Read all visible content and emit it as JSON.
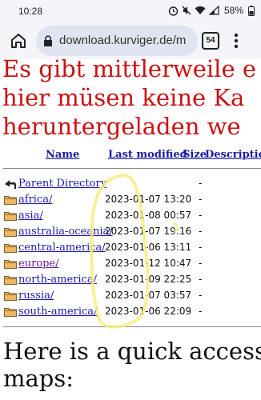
{
  "status_bar": {
    "time": "10:28",
    "battery": "58%"
  },
  "browser": {
    "url": "download.kurviger.de/m",
    "tab_count": "54"
  },
  "page": {
    "heading_lines": [
      "Es gibt mittlerweile e",
      "hier müsen keine Ka",
      "heruntergeladen we"
    ],
    "columns": {
      "name": "Name",
      "last_modified": "Last modified",
      "size": "Size",
      "description": "Description"
    },
    "parent": {
      "label": "Parent Directory",
      "size": "-"
    },
    "rows": [
      {
        "name": "africa/",
        "date": "2023-01-07 13:20",
        "size": "-"
      },
      {
        "name": "asia/",
        "date": "2023-01-08 00:57",
        "size": "-"
      },
      {
        "name": "australia-oceania/",
        "date": "2023-01-07 19:16",
        "size": "-"
      },
      {
        "name": "central-america/",
        "date": "2023-01-06 13:11",
        "size": "-"
      },
      {
        "name": "europe/",
        "date": "2023-01-12 10:47",
        "size": "-"
      },
      {
        "name": "north-america/",
        "date": "2023-01-09 22:25",
        "size": "-"
      },
      {
        "name": "russia/",
        "date": "2023-01-07 03:57",
        "size": "-"
      },
      {
        "name": "south-america/",
        "date": "2023-01-06 22:09",
        "size": "-"
      }
    ],
    "quick_lines": [
      "Here is a quick access",
      "maps:"
    ]
  },
  "colors": {
    "heading_red": "#cc1111",
    "link_blue": "#1a1aa6",
    "visited_purple": "#6a1a8a",
    "highlight": "#f2ee7a"
  }
}
